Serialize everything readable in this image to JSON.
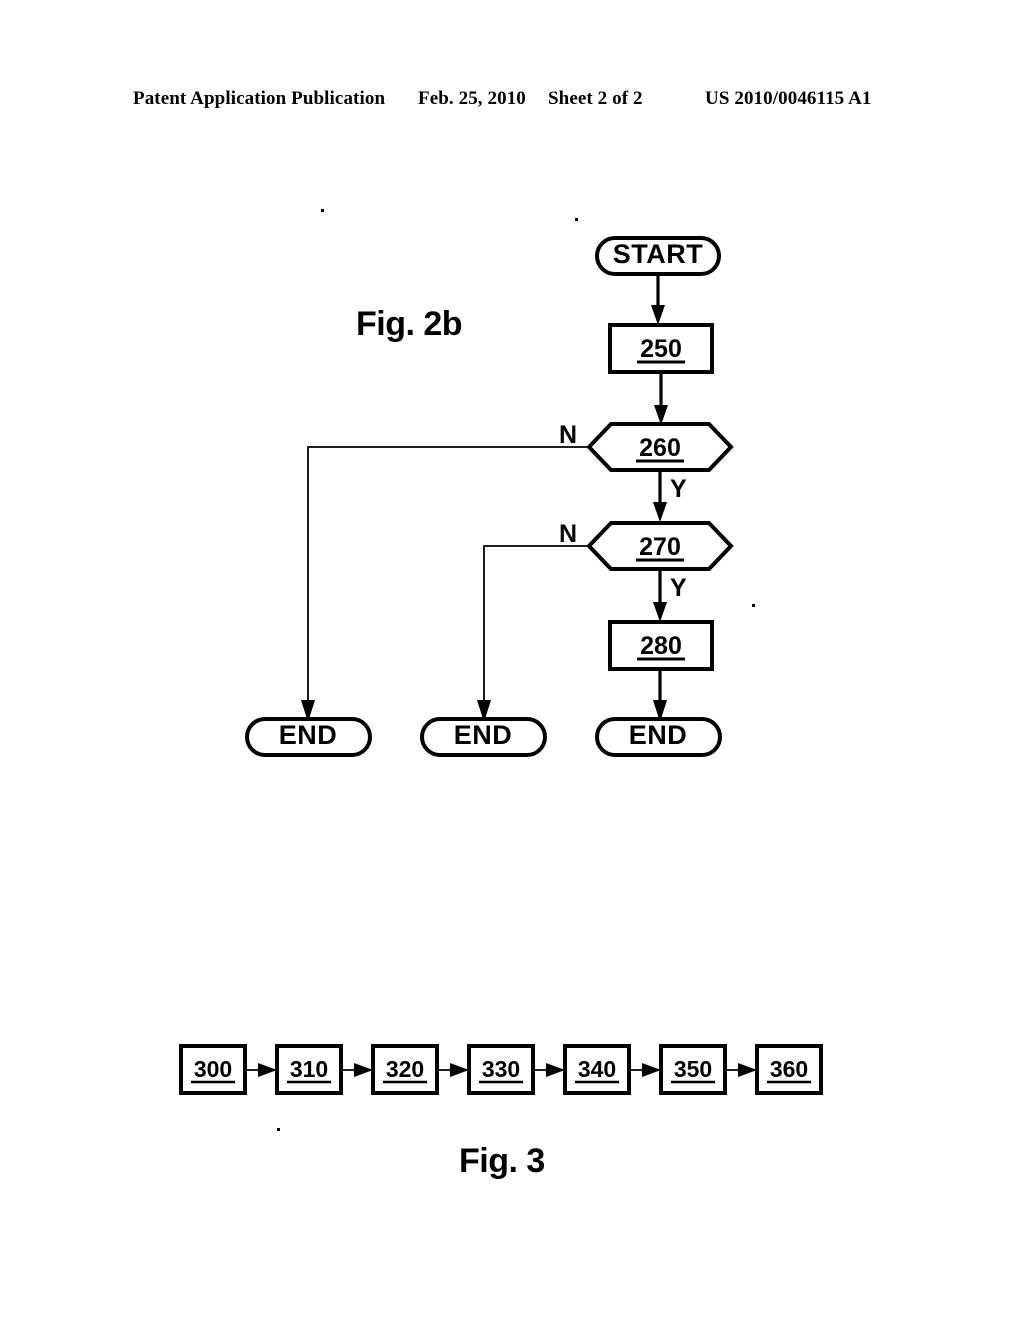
{
  "header": {
    "publication": "Patent Application Publication",
    "date": "Feb. 25, 2010",
    "sheet": "Sheet 2 of 2",
    "number": "US 2010/0046115 A1"
  },
  "figures": {
    "fig2b": {
      "label": "Fig. 2b",
      "nodes": [
        {
          "id": "start",
          "type": "terminator",
          "label": "START"
        },
        {
          "id": "250",
          "type": "process",
          "label": "250"
        },
        {
          "id": "260",
          "type": "decision",
          "label": "260"
        },
        {
          "id": "270",
          "type": "decision",
          "label": "270"
        },
        {
          "id": "280",
          "type": "process",
          "label": "280"
        },
        {
          "id": "end1",
          "type": "terminator",
          "label": "END"
        },
        {
          "id": "end2",
          "type": "terminator",
          "label": "END"
        },
        {
          "id": "end3",
          "type": "terminator",
          "label": "END"
        }
      ],
      "edges": [
        {
          "from": "start",
          "to": "250",
          "label": ""
        },
        {
          "from": "250",
          "to": "260",
          "label": ""
        },
        {
          "from": "260",
          "to": "270",
          "label": "Y"
        },
        {
          "from": "260",
          "to": "end1",
          "label": "N"
        },
        {
          "from": "270",
          "to": "280",
          "label": "Y"
        },
        {
          "from": "270",
          "to": "end2",
          "label": "N"
        },
        {
          "from": "280",
          "to": "end3",
          "label": ""
        }
      ],
      "branch_labels": {
        "n_260": "N",
        "y_260": "Y",
        "n_270": "N",
        "y_270": "Y"
      }
    },
    "fig3": {
      "label": "Fig. 3",
      "chain": [
        "300",
        "310",
        "320",
        "330",
        "340",
        "350",
        "360"
      ]
    }
  },
  "colors": {
    "ink": "#000000",
    "paper": "#ffffff"
  }
}
